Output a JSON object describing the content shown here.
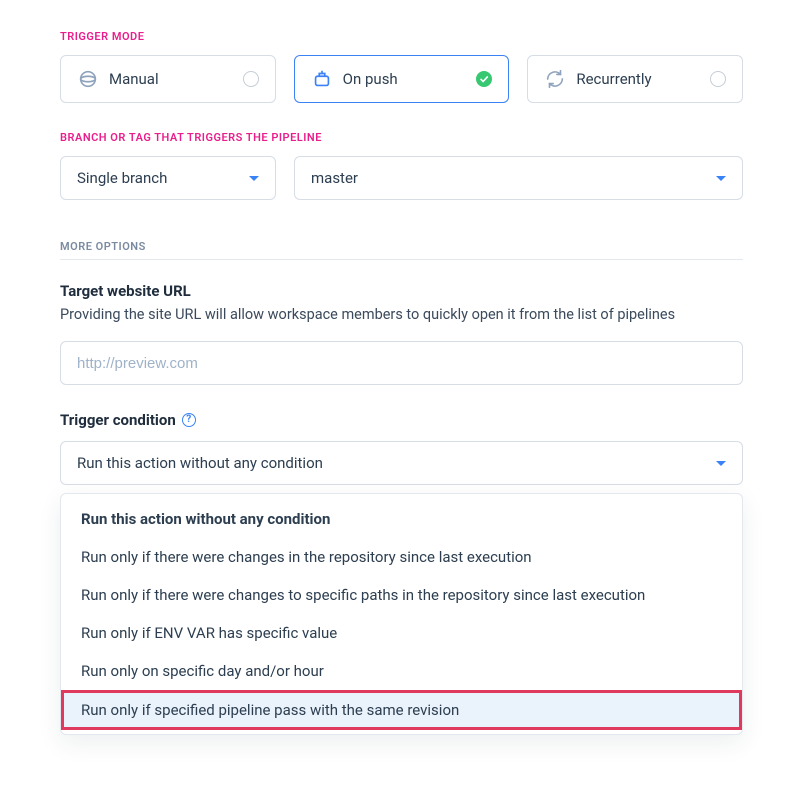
{
  "trigger_mode": {
    "label": "TRIGGER MODE",
    "options": [
      {
        "label": "Manual",
        "icon": "manual",
        "selected": false
      },
      {
        "label": "On push",
        "icon": "push",
        "selected": true
      },
      {
        "label": "Recurrently",
        "icon": "recurrent",
        "selected": false
      }
    ]
  },
  "branch_section": {
    "label": "BRANCH OR TAG THAT TRIGGERS THE PIPELINE",
    "type_select": "Single branch",
    "branch_select": "master"
  },
  "more_options": {
    "label": "MORE OPTIONS",
    "target_url": {
      "title": "Target website URL",
      "desc": "Providing the site URL will allow workspace members to quickly open it from the list of pipelines",
      "placeholder": "http://preview.com",
      "value": ""
    },
    "trigger_condition": {
      "title": "Trigger condition",
      "selected": "Run this action without any condition",
      "options": [
        "Run this action without any condition",
        "Run only if there were changes in the repository since last execution",
        "Run only if there were changes to specific paths in the repository since last execution",
        "Run only if ENV VAR has specific value",
        "Run only on specific day and/or hour",
        "Run only if specified pipeline pass with the same revision"
      ],
      "highlighted_index": 5
    }
  }
}
